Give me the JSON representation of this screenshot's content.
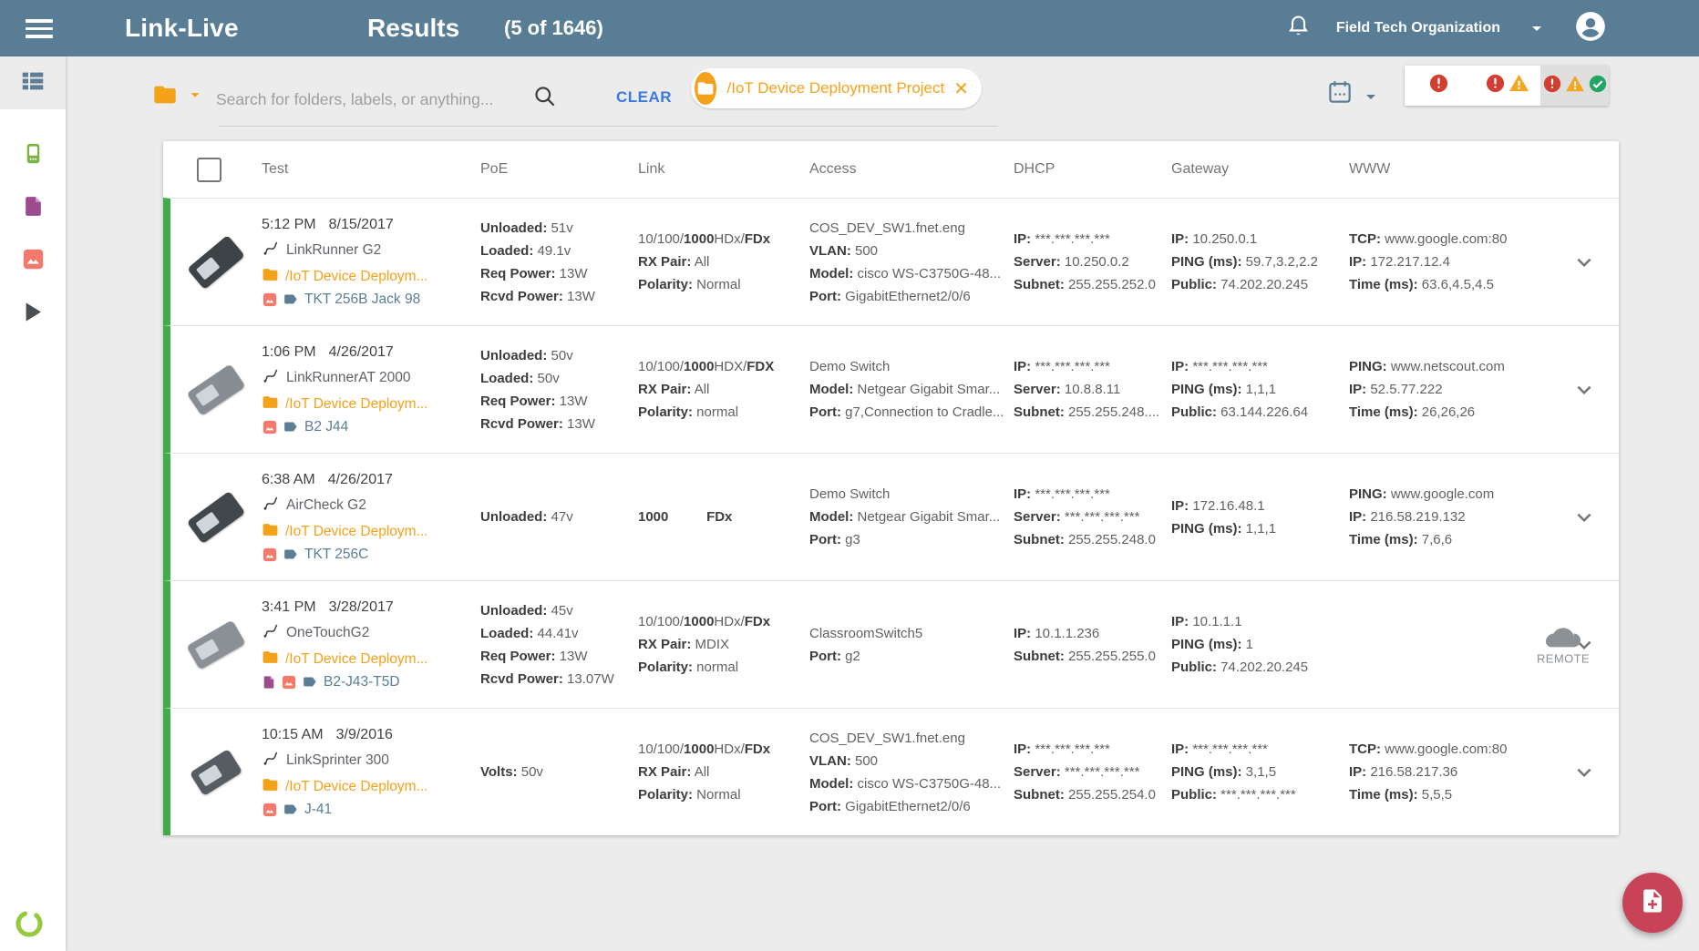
{
  "colors": {
    "topbar": "#5A7D96",
    "accent_orange": "#F5A21B",
    "link_blue": "#3B78E7",
    "label_blue": "#5B7E96",
    "row_status_green": "#3FAE49",
    "error_red": "#D23F31",
    "warning_amber": "#F5A623",
    "success_green": "#23A566",
    "fab_red": "#C94358"
  },
  "topbar": {
    "app_title": "Link-Live",
    "page_title": "Results",
    "result_count": "(5 of 1646)",
    "organization": "Field Tech Organization"
  },
  "toolbar": {
    "search_placeholder": "Search for folders, labels, or anything...",
    "clear_label": "CLEAR",
    "filter_chip": "/IoT Device Deployment Project"
  },
  "table": {
    "headers": [
      "Test",
      "PoE",
      "Link",
      "Access",
      "DHCP",
      "Gateway",
      "WWW"
    ],
    "remote_label": "REMOTE",
    "rows": [
      {
        "time": "5:12 PM",
        "date": "8/15/2017",
        "device": "LinkRunner G2",
        "folder": "/IoT Device Deploym...",
        "label": {
          "icons": [
            "image",
            "tag"
          ],
          "text": "TKT 256B Jack 98"
        },
        "cells": {
          "poe": [
            [
              [
                "Unloaded:",
                1
              ],
              [
                " 51v",
                0
              ]
            ],
            [
              [
                "Loaded:",
                1
              ],
              [
                " 49.1v",
                0
              ]
            ],
            [
              [
                "Req Power:",
                1
              ],
              [
                " 13W",
                0
              ]
            ],
            [
              [
                "Rcvd Power:",
                1
              ],
              [
                " 13W",
                0
              ]
            ]
          ],
          "link": [
            [
              [
                "10/100/",
                0
              ],
              [
                "1000",
                1
              ],
              [
                "HDx/",
                0
              ],
              [
                "FDx",
                1
              ]
            ],
            [
              [
                "RX Pair:",
                1
              ],
              [
                " All",
                0
              ]
            ],
            [
              [
                "Polarity:",
                1
              ],
              [
                " Normal",
                0
              ]
            ]
          ],
          "access": [
            [
              [
                "COS_DEV_SW1.fnet.eng",
                0
              ]
            ],
            [
              [
                "VLAN:",
                1
              ],
              [
                " 500",
                0
              ]
            ],
            [
              [
                "Model:",
                1
              ],
              [
                " cisco WS-C3750G-48...",
                0
              ]
            ],
            [
              [
                "Port:",
                1
              ],
              [
                " GigabitEthernet2/0/6",
                0
              ]
            ]
          ],
          "dhcp": [
            [
              [
                "IP:",
                1
              ],
              [
                " ***.***.***.***",
                0
              ]
            ],
            [
              [
                "Server:",
                1
              ],
              [
                " 10.250.0.2",
                0
              ]
            ],
            [
              [
                "Subnet:",
                1
              ],
              [
                " 255.255.252.0",
                0
              ]
            ]
          ],
          "gateway": [
            [
              [
                "IP:",
                1
              ],
              [
                " 10.250.0.1",
                0
              ]
            ],
            [
              [
                "PING (ms):",
                1
              ],
              [
                " 59.7,3.2,2.2",
                0
              ]
            ],
            [
              [
                "Public:",
                1
              ],
              [
                " 74.202.20.245",
                0
              ]
            ]
          ],
          "www": [
            [
              [
                "TCP:",
                1
              ],
              [
                " www.google.com:80",
                0
              ]
            ],
            [
              [
                "IP:",
                1
              ],
              [
                " 172.217.12.4",
                0
              ]
            ],
            [
              [
                "Time (ms):",
                1
              ],
              [
                " 63.6,4.5,4.5",
                0
              ]
            ]
          ]
        },
        "remote": false
      },
      {
        "time": "1:06 PM",
        "date": "4/26/2017",
        "device": "LinkRunnerAT 2000",
        "folder": "/IoT Device Deploym...",
        "label": {
          "icons": [
            "image",
            "tag"
          ],
          "text": "B2 J44"
        },
        "cells": {
          "poe": [
            [
              [
                "Unloaded:",
                1
              ],
              [
                " 50v",
                0
              ]
            ],
            [
              [
                "Loaded:",
                1
              ],
              [
                " 50v",
                0
              ]
            ],
            [
              [
                "Req Power:",
                1
              ],
              [
                " 13W",
                0
              ]
            ],
            [
              [
                "Rcvd Power:",
                1
              ],
              [
                " 13W",
                0
              ]
            ]
          ],
          "link": [
            [
              [
                "10/100/",
                0
              ],
              [
                "1000",
                1
              ],
              [
                "HDX/",
                0
              ],
              [
                "FDX",
                1
              ]
            ],
            [
              [
                "RX Pair:",
                1
              ],
              [
                " All",
                0
              ]
            ],
            [
              [
                "Polarity:",
                1
              ],
              [
                " normal",
                0
              ]
            ]
          ],
          "access": [
            [
              [
                "Demo Switch",
                0
              ]
            ],
            [
              [
                "Model:",
                1
              ],
              [
                " Netgear Gigabit Smar...",
                0
              ]
            ],
            [
              [
                "Port:",
                1
              ],
              [
                " g7,Connection to Cradle...",
                0
              ]
            ]
          ],
          "dhcp": [
            [
              [
                "IP:",
                1
              ],
              [
                " ***.***.***.***",
                0
              ]
            ],
            [
              [
                "Server:",
                1
              ],
              [
                " 10.8.8.11",
                0
              ]
            ],
            [
              [
                "Subnet:",
                1
              ],
              [
                " 255.255.248....",
                0
              ]
            ]
          ],
          "gateway": [
            [
              [
                "IP:",
                1
              ],
              [
                " ***.***.***.***",
                0
              ]
            ],
            [
              [
                "PING (ms):",
                1
              ],
              [
                " 1,1,1",
                0
              ]
            ],
            [
              [
                "Public:",
                1
              ],
              [
                " 63.144.226.64",
                0
              ]
            ]
          ],
          "www": [
            [
              [
                "PING:",
                1
              ],
              [
                " www.netscout.com",
                0
              ]
            ],
            [
              [
                "IP:",
                1
              ],
              [
                " 52.5.77.222",
                0
              ]
            ],
            [
              [
                "Time (ms):",
                1
              ],
              [
                " 26,26,26",
                0
              ]
            ]
          ]
        },
        "remote": false
      },
      {
        "time": "6:38 AM",
        "date": "4/26/2017",
        "device": "AirCheck G2",
        "folder": "/IoT Device Deploym...",
        "label": {
          "icons": [
            "image",
            "tag"
          ],
          "text": "TKT 256C"
        },
        "cells": {
          "poe": [
            [
              [
                "Unloaded:",
                1
              ],
              [
                " 47v",
                0
              ]
            ]
          ],
          "link": [
            [
              [
                "1000",
                1
              ],
              [
                "          ",
                0
              ],
              [
                "FDx",
                1
              ]
            ]
          ],
          "access": [
            [
              [
                "Demo Switch",
                0
              ]
            ],
            [
              [
                "Model:",
                1
              ],
              [
                " Netgear Gigabit Smar...",
                0
              ]
            ],
            [
              [
                "Port:",
                1
              ],
              [
                " g3",
                0
              ]
            ]
          ],
          "dhcp": [
            [
              [
                "IP:",
                1
              ],
              [
                " ***.***.***.***",
                0
              ]
            ],
            [
              [
                "Server:",
                1
              ],
              [
                " ***.***.***.***",
                0
              ]
            ],
            [
              [
                "Subnet:",
                1
              ],
              [
                " 255.255.248.0",
                0
              ]
            ]
          ],
          "gateway": [
            [
              [
                "IP:",
                1
              ],
              [
                " 172.16.48.1",
                0
              ]
            ],
            [
              [
                "PING (ms):",
                1
              ],
              [
                " 1,1,1",
                0
              ]
            ]
          ],
          "www": [
            [
              [
                "PING:",
                1
              ],
              [
                " www.google.com",
                0
              ]
            ],
            [
              [
                "IP:",
                1
              ],
              [
                " 216.58.219.132",
                0
              ]
            ],
            [
              [
                "Time (ms):",
                1
              ],
              [
                " 7,6,6",
                0
              ]
            ]
          ]
        },
        "remote": false
      },
      {
        "time": "3:41 PM",
        "date": "3/28/2017",
        "device": "OneTouchG2",
        "folder": "/IoT Device Deploym...",
        "label": {
          "icons": [
            "doc",
            "image",
            "tag"
          ],
          "text": "B2-J43-T5D"
        },
        "cells": {
          "poe": [
            [
              [
                "Unloaded:",
                1
              ],
              [
                " 45v",
                0
              ]
            ],
            [
              [
                "Loaded:",
                1
              ],
              [
                " 44.41v",
                0
              ]
            ],
            [
              [
                "Req Power:",
                1
              ],
              [
                " 13W",
                0
              ]
            ],
            [
              [
                "Rcvd Power:",
                1
              ],
              [
                " 13.07W",
                0
              ]
            ]
          ],
          "link": [
            [
              [
                "10/100/",
                0
              ],
              [
                "1000",
                1
              ],
              [
                "HDx/",
                0
              ],
              [
                "FDx",
                1
              ]
            ],
            [
              [
                "RX Pair:",
                1
              ],
              [
                " MDIX",
                0
              ]
            ],
            [
              [
                "Polarity:",
                1
              ],
              [
                " normal",
                0
              ]
            ]
          ],
          "access": [
            [
              [
                "ClassroomSwitch5",
                0
              ]
            ],
            [
              [
                "Port:",
                1
              ],
              [
                " g2",
                0
              ]
            ]
          ],
          "dhcp": [
            [
              [
                "IP:",
                1
              ],
              [
                " 10.1.1.236",
                0
              ]
            ],
            [
              [
                "Subnet:",
                1
              ],
              [
                " 255.255.255.0",
                0
              ]
            ]
          ],
          "gateway": [
            [
              [
                "IP:",
                1
              ],
              [
                " 10.1.1.1",
                0
              ]
            ],
            [
              [
                "PING (ms):",
                1
              ],
              [
                " 1",
                0
              ]
            ],
            [
              [
                "Public:",
                1
              ],
              [
                " 74.202.20.245",
                0
              ]
            ]
          ],
          "www": []
        },
        "remote": true
      },
      {
        "time": "10:15 AM",
        "date": "3/9/2016",
        "device": "LinkSprinter 300",
        "folder": "/IoT Device Deploym...",
        "label": {
          "icons": [
            "image",
            "tag"
          ],
          "text": "J-41"
        },
        "cells": {
          "poe": [
            [
              [
                "Volts:",
                1
              ],
              [
                " 50v",
                0
              ]
            ]
          ],
          "link": [
            [
              [
                "10/100/",
                0
              ],
              [
                "1000",
                1
              ],
              [
                "HDx/",
                0
              ],
              [
                "FDx",
                1
              ]
            ],
            [
              [
                "RX Pair:",
                1
              ],
              [
                " All",
                0
              ]
            ],
            [
              [
                "Polarity:",
                1
              ],
              [
                " Normal",
                0
              ]
            ]
          ],
          "access": [
            [
              [
                "COS_DEV_SW1.fnet.eng",
                0
              ]
            ],
            [
              [
                "VLAN:",
                1
              ],
              [
                " 500",
                0
              ]
            ],
            [
              [
                "Model:",
                1
              ],
              [
                " cisco WS-C3750G-48...",
                0
              ]
            ],
            [
              [
                "Port:",
                1
              ],
              [
                " GigabitEthernet2/0/6",
                0
              ]
            ]
          ],
          "dhcp": [
            [
              [
                "IP:",
                1
              ],
              [
                " ***.***.***.***",
                0
              ]
            ],
            [
              [
                "Server:",
                1
              ],
              [
                " ***.***.***.***",
                0
              ]
            ],
            [
              [
                "Subnet:",
                1
              ],
              [
                " 255.255.254.0",
                0
              ]
            ]
          ],
          "gateway": [
            [
              [
                "IP:",
                1
              ],
              [
                " ***.***.***.***",
                0
              ]
            ],
            [
              [
                "PING (ms):",
                1
              ],
              [
                " 3,1,5",
                0
              ]
            ],
            [
              [
                "Public:",
                1
              ],
              [
                " ***.***.***.***",
                0
              ]
            ]
          ],
          "www": [
            [
              [
                "TCP:",
                1
              ],
              [
                " www.google.com:80",
                0
              ]
            ],
            [
              [
                "IP:",
                1
              ],
              [
                " 216.58.217.36",
                0
              ]
            ],
            [
              [
                "Time (ms):",
                1
              ],
              [
                " 5,5,5",
                0
              ]
            ]
          ]
        },
        "remote": false
      }
    ]
  }
}
